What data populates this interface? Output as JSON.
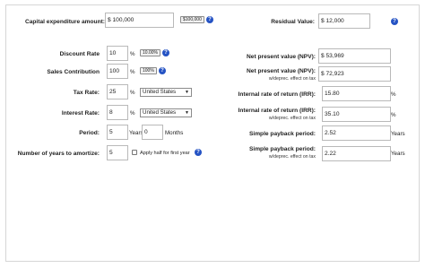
{
  "left": {
    "capex": {
      "label": "Capital expenditure amount:",
      "currency": "$",
      "value": "100,000",
      "chip": "$100,000"
    },
    "discount_rate": {
      "label": "Discount Rate",
      "value": "10",
      "unit": "%",
      "chip": "10.00%"
    },
    "sales_contribution": {
      "label": "Sales Contribution",
      "value": "100",
      "unit": "%",
      "chip": "100%"
    },
    "tax_rate": {
      "label": "Tax Rate:",
      "value": "25",
      "unit": "%",
      "select": "United States"
    },
    "interest_rate": {
      "label": "Interest Rate:",
      "value": "8",
      "unit": "%",
      "select": "United States"
    },
    "period": {
      "label": "Period:",
      "years_value": "5",
      "years_unit": "Years",
      "months_value": "0",
      "months_unit": "Months"
    },
    "amortize": {
      "label": "Number of years to amortize:",
      "value": "5",
      "checkbox_label": "Apply half for first year"
    }
  },
  "right": {
    "residual": {
      "label": "Residual Value:",
      "currency": "$",
      "value": "12,000"
    },
    "npv": {
      "label": "Net present value (NPV):",
      "currency": "$",
      "value": "53,969"
    },
    "npv_dep": {
      "label": "Net present value (NPV):",
      "sub": "w/deprec. effect on tax",
      "currency": "$",
      "value": "72,923"
    },
    "irr": {
      "label": "Internal rate of return (IRR):",
      "value": "15.80",
      "unit": "%"
    },
    "irr_dep": {
      "label": "Internal rate of return (IRR):",
      "sub": "w/deprec. effect on tax",
      "value": "35.10",
      "unit": "%"
    },
    "payback": {
      "label": "Simple payback period:",
      "value": "2.52",
      "unit": "Years"
    },
    "payback_dep": {
      "label": "Simple payback period:",
      "sub": "w/deprec. effect on tax",
      "value": "2.22",
      "unit": "Years"
    }
  },
  "help_glyph": "?",
  "select_arrow": "▼",
  "colors": {
    "help": "#2553c4",
    "border": "#b9b9b9"
  }
}
